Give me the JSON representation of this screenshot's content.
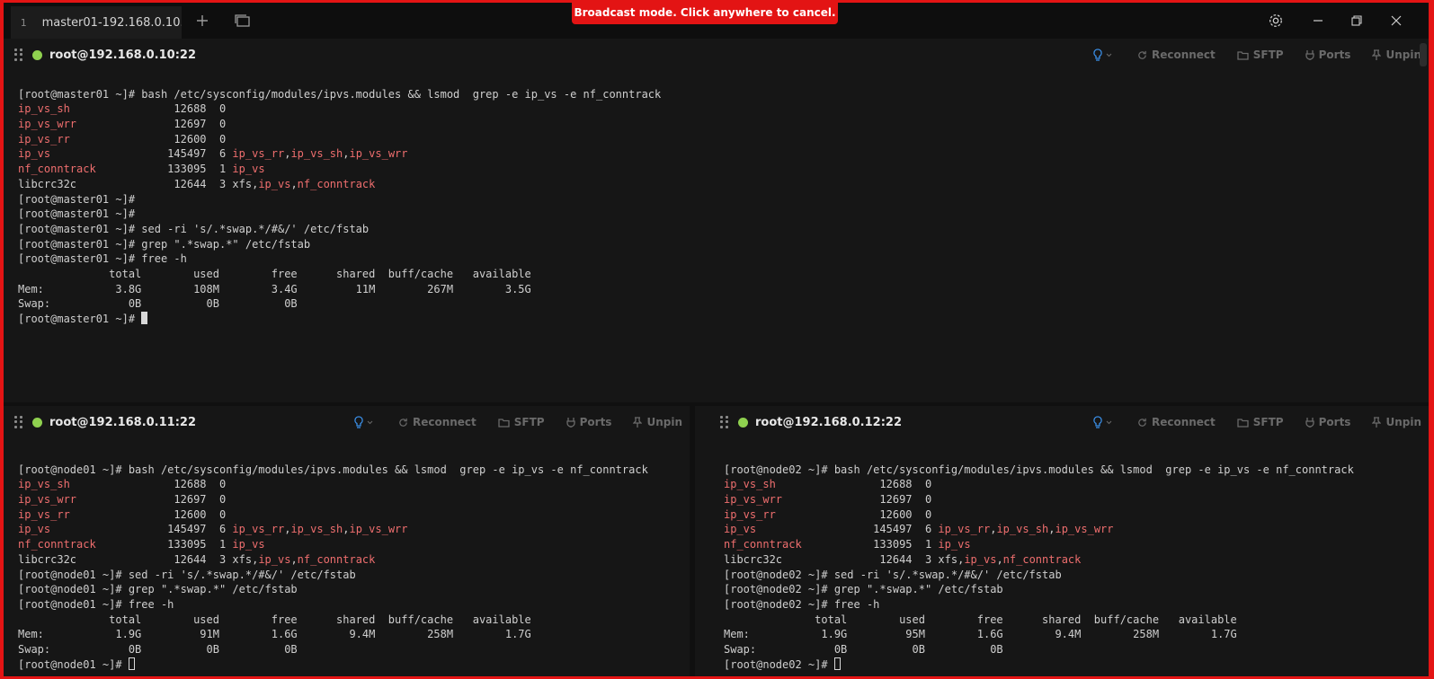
{
  "tabs": [
    {
      "index": "1",
      "title": "master01-192.168.0.10..."
    }
  ],
  "broadcast": "Broadcast mode. Click anywhere to cancel.",
  "pane_actions": {
    "reconnect": "Reconnect",
    "sftp": "SFTP",
    "ports": "Ports",
    "unpin": "Unpin"
  },
  "panes": {
    "master": {
      "title": "root@192.168.0.10:22",
      "lines": [
        "",
        "[root@master01 ~]# bash /etc/sysconfig/modules/ipvs.modules && lsmod | grep -e ip_vs -e nf_conntrack",
        "ip_vs_sh|                12688  0",
        "ip_vs_wrr|               12697  0",
        "ip_vs_rr|                12600  0",
        "ip_vs|                  145497  6 |ip_vs_rr|,|ip_vs_sh|,|ip_vs_wrr",
        "nf_conntrack|           133095  1 |ip_vs",
        "libcrc32c               12644  3 xfs,|ip_vs|,|nf_conntrack",
        "[root@master01 ~]#",
        "[root@master01 ~]#",
        "[root@master01 ~]# sed -ri 's/.*swap.*/#&/' /etc/fstab",
        "[root@master01 ~]# grep \".*swap.*\" /etc/fstab",
        "[root@master01 ~]# free -h",
        "              total        used        free      shared  buff/cache   available",
        "Mem:           3.8G        108M        3.4G         11M        267M        3.5G",
        "Swap:            0B          0B          0B",
        "[root@master01 ~]# "
      ]
    },
    "node01": {
      "title": "root@192.168.0.11:22",
      "lines": [
        "",
        "[root@node01 ~]# bash /etc/sysconfig/modules/ipvs.modules && lsmod | grep -e ip_vs -e nf_conntrack",
        "ip_vs_sh|                12688  0",
        "ip_vs_wrr|               12697  0",
        "ip_vs_rr|                12600  0",
        "ip_vs|                  145497  6 |ip_vs_rr|,|ip_vs_sh|,|ip_vs_wrr",
        "nf_conntrack|           133095  1 |ip_vs",
        "libcrc32c               12644  3 xfs,|ip_vs|,|nf_conntrack",
        "[root@node01 ~]# sed -ri 's/.*swap.*/#&/' /etc/fstab",
        "[root@node01 ~]# grep \".*swap.*\" /etc/fstab",
        "[root@node01 ~]# free -h",
        "              total        used        free      shared  buff/cache   available",
        "Mem:           1.9G         91M        1.6G        9.4M        258M        1.7G",
        "Swap:            0B          0B          0B",
        "[root@node01 ~]# "
      ]
    },
    "node02": {
      "title": "root@192.168.0.12:22",
      "lines": [
        "",
        "[root@node02 ~]# bash /etc/sysconfig/modules/ipvs.modules && lsmod | grep -e ip_vs -e nf_conntrack",
        "ip_vs_sh|                12688  0",
        "ip_vs_wrr|               12697  0",
        "ip_vs_rr|                12600  0",
        "ip_vs|                  145497  6 |ip_vs_rr|,|ip_vs_sh|,|ip_vs_wrr",
        "nf_conntrack|           133095  1 |ip_vs",
        "libcrc32c               12644  3 xfs,|ip_vs|,|nf_conntrack",
        "[root@node02 ~]# sed -ri 's/.*swap.*/#&/' /etc/fstab",
        "[root@node02 ~]# grep \".*swap.*\" /etc/fstab",
        "[root@node02 ~]# free -h",
        "              total        used        free      shared  buff/cache   available",
        "Mem:           1.9G         95M        1.6G        9.4M        258M        1.7G",
        "Swap:            0B          0B          0B",
        "[root@node02 ~]# "
      ]
    }
  },
  "colors": {
    "broadcast_border": "#e31414",
    "status_dot": "#8fd14f",
    "highlight": "#ee6e6e",
    "bulb": "#3a8ee6"
  }
}
